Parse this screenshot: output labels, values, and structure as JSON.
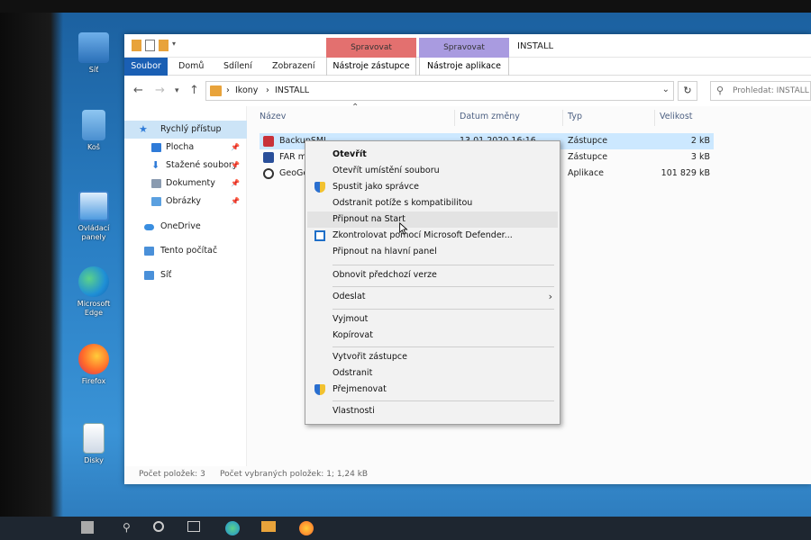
{
  "desktop": {
    "icons": [
      {
        "name": "Síť",
        "icon": "network-icon"
      },
      {
        "name": "Koš",
        "icon": "recycle-bin-icon"
      },
      {
        "name": "Ovládací panely",
        "icon": "control-panel-icon"
      },
      {
        "name": "Microsoft Edge",
        "icon": "edge-icon"
      },
      {
        "name": "Firefox",
        "icon": "firefox-icon"
      },
      {
        "name": "Disky",
        "icon": "disk-icon"
      }
    ]
  },
  "window": {
    "title": "INSTALL",
    "context_tabs": [
      {
        "label": "Spravovat",
        "sub": "Nástroje zástupce",
        "color": "#e3706f"
      },
      {
        "label": "Spravovat",
        "sub": "Nástroje aplikace",
        "color": "#a99be0"
      }
    ],
    "ribbon_tabs": [
      "Soubor",
      "Domů",
      "Sdílení",
      "Zobrazení"
    ],
    "address": {
      "breadcrumbs": [
        "Ikony",
        "INSTALL"
      ],
      "search_placeholder": "Prohledat: INSTALL"
    },
    "navpane": {
      "quick_access": "Rychlý přístup",
      "pinned": [
        {
          "label": "Plocha",
          "color": "#2f7bd8"
        },
        {
          "label": "Stažené soubory",
          "color": "#2f7bd8"
        },
        {
          "label": "Dokumenty",
          "color": "#8a9bb0"
        },
        {
          "label": "Obrázky",
          "color": "#5aa0e0"
        }
      ],
      "onedrive": "OneDrive",
      "this_pc": "Tento počítač",
      "network": "Síť"
    },
    "columns": [
      "Název",
      "Datum změny",
      "Typ",
      "Velikost"
    ],
    "files": [
      {
        "name": "BackupSMI",
        "date": "13.01.2020 16:16",
        "type": "Zástupce",
        "size": "2 kB",
        "selected": true
      },
      {
        "name": "FAR ma",
        "date": "",
        "type": "Zástupce",
        "size": "3 kB",
        "selected": false
      },
      {
        "name": "GeoGe",
        "date": "",
        "type": "Aplikace",
        "size": "101 829 kB",
        "selected": false
      }
    ],
    "status": {
      "count": "Počet položek: 3",
      "selected": "Počet vybraných položek: 1; 1,24 kB"
    }
  },
  "context_menu": {
    "items": [
      {
        "label": "Otevřít",
        "bold": true,
        "icon": ""
      },
      {
        "label": "Otevřít umístění souboru",
        "icon": ""
      },
      {
        "label": "Spustit jako správce",
        "icon": "shield-icon"
      },
      {
        "label": "Odstranit potíže s kompatibilitou",
        "icon": ""
      },
      {
        "label": "Připnout na Start",
        "icon": "",
        "hover": true
      },
      {
        "label": "Zkontrolovat pomocí Microsoft Defender...",
        "icon": "defender-icon"
      },
      {
        "label": "Připnout na hlavní panel",
        "icon": ""
      },
      {
        "label": "Obnovit předchozí verze",
        "icon": ""
      },
      {
        "label": "Odeslat",
        "icon": "",
        "submenu": true
      },
      {
        "label": "Vyjmout",
        "icon": ""
      },
      {
        "label": "Kopírovat",
        "icon": ""
      },
      {
        "label": "Vytvořit zástupce",
        "icon": ""
      },
      {
        "label": "Odstranit",
        "icon": ""
      },
      {
        "label": "Přejmenovat",
        "icon": "shield-icon"
      },
      {
        "label": "Vlastnosti",
        "icon": ""
      }
    ]
  },
  "colors": {
    "accent": "#1a5fb4",
    "selection": "#cce8ff",
    "folder": "#e8a33b"
  }
}
